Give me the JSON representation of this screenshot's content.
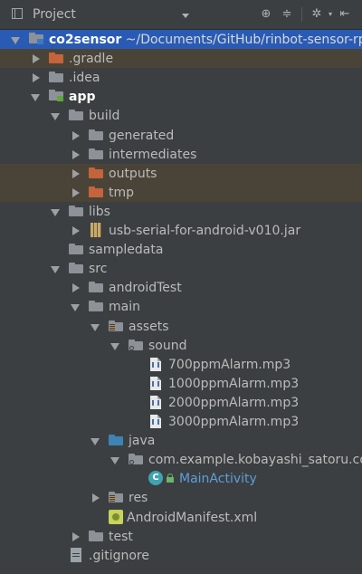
{
  "toolbar": {
    "title": "Project",
    "icons": [
      "project-view-icon",
      "locate-icon",
      "collapse-all-icon",
      "gear-icon",
      "hide-icon"
    ]
  },
  "tree": [
    {
      "name": "root",
      "label": "co2sensor",
      "path": "~/Documents/GitHub/rinbot-sensor-rp",
      "depth": 0,
      "expanded": true,
      "icon": "module-icon",
      "style": "bold",
      "selected": true
    },
    {
      "name": "gradle",
      "label": ".gradle",
      "depth": 1,
      "expanded": false,
      "icon": "orange-folder",
      "excluded": true
    },
    {
      "name": "idea",
      "label": ".idea",
      "depth": 1,
      "expanded": false,
      "icon": "gray-folder"
    },
    {
      "name": "app",
      "label": "app",
      "depth": 1,
      "expanded": true,
      "icon": "module-folder",
      "style": "bold"
    },
    {
      "name": "build",
      "label": "build",
      "depth": 2,
      "expanded": true,
      "icon": "gray-folder"
    },
    {
      "name": "generated",
      "label": "generated",
      "depth": 3,
      "expanded": false,
      "icon": "gray-folder"
    },
    {
      "name": "intermediates",
      "label": "intermediates",
      "depth": 3,
      "expanded": false,
      "icon": "gray-folder"
    },
    {
      "name": "outputs",
      "label": "outputs",
      "depth": 3,
      "expanded": false,
      "icon": "orange-folder",
      "excluded": true
    },
    {
      "name": "tmp",
      "label": "tmp",
      "depth": 3,
      "expanded": false,
      "icon": "orange-folder",
      "excluded": true
    },
    {
      "name": "libs",
      "label": "libs",
      "depth": 2,
      "expanded": true,
      "icon": "gray-folder"
    },
    {
      "name": "jar",
      "label": "usb-serial-for-android-v010.jar",
      "depth": 3,
      "expanded": false,
      "icon": "jar-icon"
    },
    {
      "name": "sampledata",
      "label": "sampledata",
      "depth": 2,
      "icon": "gray-folder"
    },
    {
      "name": "src",
      "label": "src",
      "depth": 2,
      "expanded": true,
      "icon": "gray-folder"
    },
    {
      "name": "androidTest",
      "label": "androidTest",
      "depth": 3,
      "expanded": false,
      "icon": "gray-folder"
    },
    {
      "name": "main",
      "label": "main",
      "depth": 3,
      "expanded": true,
      "icon": "gray-folder"
    },
    {
      "name": "assets",
      "label": "assets",
      "depth": 4,
      "expanded": true,
      "icon": "assets-folder"
    },
    {
      "name": "sound",
      "label": "sound",
      "depth": 5,
      "expanded": true,
      "icon": "dot-folder"
    },
    {
      "name": "mp3-700",
      "label": "700ppmAlarm.mp3",
      "depth": 6,
      "icon": "audio-file"
    },
    {
      "name": "mp3-1000",
      "label": "1000ppmAlarm.mp3",
      "depth": 6,
      "icon": "audio-file"
    },
    {
      "name": "mp3-2000",
      "label": "2000ppmAlarm.mp3",
      "depth": 6,
      "icon": "audio-file"
    },
    {
      "name": "mp3-3000",
      "label": "3000ppmAlarm.mp3",
      "depth": 6,
      "icon": "audio-file"
    },
    {
      "name": "java",
      "label": "java",
      "depth": 4,
      "expanded": true,
      "icon": "blue-folder"
    },
    {
      "name": "package",
      "label": "com.example.kobayashi_satoru.co",
      "depth": 5,
      "expanded": true,
      "icon": "dot-folder"
    },
    {
      "name": "mainactivity",
      "label": "MainActivity",
      "depth": 6,
      "icon": "class-icon",
      "style": "blue"
    },
    {
      "name": "res",
      "label": "res",
      "depth": 4,
      "expanded": false,
      "icon": "res-folder"
    },
    {
      "name": "manifest",
      "label": "AndroidManifest.xml",
      "depth": 4,
      "icon": "manifest-icon"
    },
    {
      "name": "test",
      "label": "test",
      "depth": 3,
      "expanded": false,
      "icon": "gray-folder"
    },
    {
      "name": "gitignore",
      "label": ".gitignore",
      "depth": 2,
      "icon": "git-icon"
    }
  ]
}
